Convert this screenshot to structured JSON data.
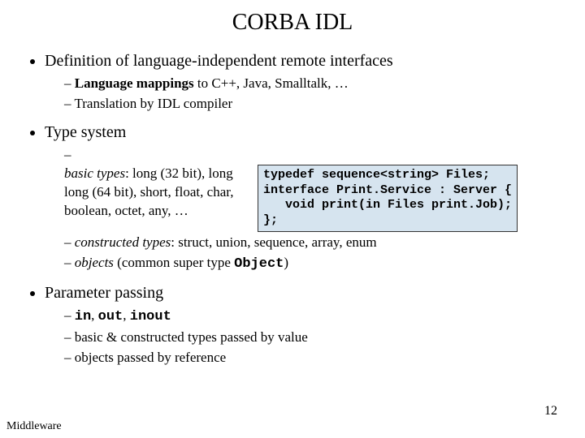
{
  "title": "CORBA IDL",
  "bullets": {
    "b1": "Definition of language-independent remote interfaces",
    "b1_1_a": "Language mappings",
    "b1_1_b": " to C++, Java, Smalltalk, …",
    "b1_2": "Translation by IDL compiler",
    "b2": "Type system",
    "b2_1_a": "basic types",
    "b2_1_b": ": long (32 bit), long long (64 bit), short, float, char, boolean, octet, any, …",
    "b2_2_a": "constructed types",
    "b2_2_b": ": struct, union, sequence, array, enum",
    "b2_3_a": "objects",
    "b2_3_b": " (common super type ",
    "b2_3_c": "Object",
    "b2_3_d": ")",
    "b3": "Parameter passing",
    "b3_1_a": "in",
    "b3_1_b": ", ",
    "b3_1_c": "out",
    "b3_1_d": ", ",
    "b3_1_e": "inout",
    "b3_2": "basic & constructed types passed by value",
    "b3_3": "objects passed by reference"
  },
  "code": "typedef sequence<string> Files;\ninterface Print.Service : Server {\n   void print(in Files print.Job);\n};",
  "footer": "Middleware",
  "page": "12"
}
